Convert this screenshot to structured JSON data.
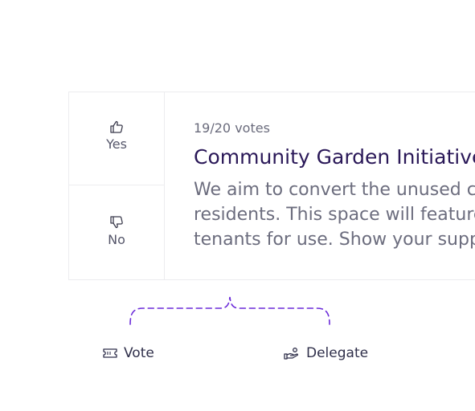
{
  "vote_panel": {
    "yes_label": "Yes",
    "no_label": "No"
  },
  "proposal": {
    "vote_count": "19/20 votes",
    "title": "Community Garden Initiative",
    "description_lines": [
      "We aim to convert the unused co",
      "residents. This space will feature",
      "tenants for use. Show your supp"
    ]
  },
  "actions": {
    "vote_label": "Vote",
    "delegate_label": "Delegate"
  },
  "colors": {
    "title": "#2a1858",
    "accent_dashed": "#6b2bd9",
    "text_muted": "#6c6d7e"
  },
  "icons": [
    "thumbs-up-icon",
    "thumbs-down-icon",
    "ticket-icon",
    "hand-coin-icon"
  ]
}
